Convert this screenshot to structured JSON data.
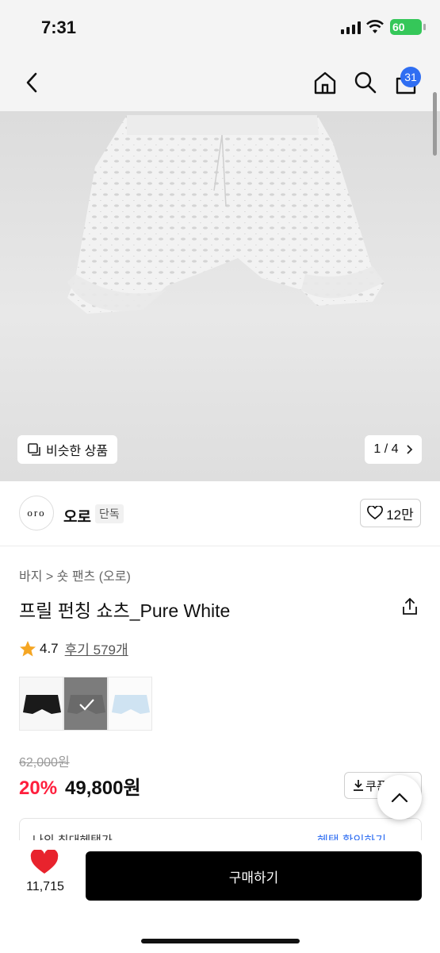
{
  "status": {
    "time": "7:31",
    "battery": "60"
  },
  "nav": {
    "back_icon": "chevron-left-icon",
    "home_icon": "home-icon",
    "search_icon": "search-icon",
    "cart_icon": "cart-icon",
    "cart_count": "31"
  },
  "gallery": {
    "similar_label": "비슷한 상품",
    "pager": "1 / 4"
  },
  "brand": {
    "logo_text": "oro",
    "name": "오로",
    "tag": "단독",
    "like_count": "12만"
  },
  "product": {
    "breadcrumb": "바지 > 숏 팬츠 (오로)",
    "title": "프릴 펀칭 쇼츠_Pure White",
    "rating": "4.7",
    "reviews": "후기 579개",
    "original_price": "62,000원",
    "discount": "20%",
    "price": "49,800원",
    "coupon_label": "쿠폰"
  },
  "benefit": {
    "left": "나의 최대혜택가",
    "right": "혜택 확인하기"
  },
  "bottom": {
    "like_count": "11,715",
    "buy_label": "구매하기"
  },
  "colors": {
    "accent": "#2f6ef2",
    "discount": "#ff1f3d",
    "heart": "#e8232d",
    "star": "#f5a623"
  }
}
